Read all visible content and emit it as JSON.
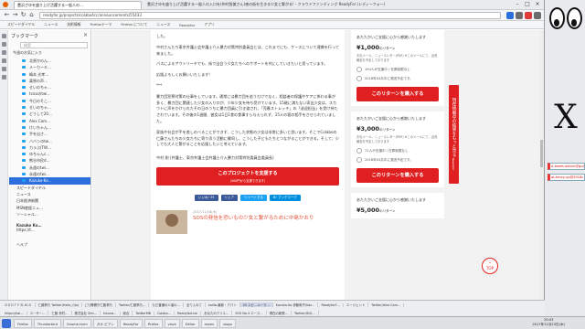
{
  "window": {
    "tab_title": "豊沢さゆを盛り上げ活躍する一般人の…",
    "title": "豊沢さゆを盛り上げ活躍する一般人の入口を(仲村智美さん)夜の街を生きる少女と繋がる! - クラウドファンディング ReadyFor (レディーフォー)",
    "url": "readyfor.jp/projects/colabo4cc/announcements/55433"
  },
  "bookmarks_bar": [
    "スピードダイヤル",
    "ニュース",
    "技術情報",
    "Firefoxテーマ",
    "Firefox について",
    "ニュース",
    "Readyfor",
    "アプリ"
  ],
  "sidebar": {
    "header": "ブックマーク",
    "search_placeholder": "検索",
    "folder": "今週のお気に入り",
    "items": [
      "北原かのん…",
      "メーカーキ…",
      "嶋本 光孝…",
      "栗原の声…",
      "せいのちゃ…",
      "tsicoのtwi…",
      "今日のそこ…",
      "せいのちゃ…",
      "どうして20…",
      "Alex Cam…",
      "けいちゃん…",
      "手を出さ…",
      "ババンのtw…",
      "カラぶ(TW…",
      "ゆちゃんc…",
      "熊谷市民d…",
      "永遠のtwi…",
      "永遠のtwi…",
      "Kazuko-Ko…"
    ],
    "selected_index": 18,
    "sections": [
      "スピードダイヤル",
      "ニュース",
      "日本経済新聞",
      "MSN産経ニュ…",
      "ソーシャル…"
    ],
    "user_name": "Kazuko Ko…",
    "user_line": "https://t…",
    "bottom_label": "ヘルプ"
  },
  "article": {
    "paragraphs": [
      "した。",
      "中村さんたち東京弁護士会弁護士介入暴力対策特別委員会とは、これまでにも、ケースについて連携を行って来ました。",
      "バスによるアウトリーチでも、街で出会う少女たちへのサポートを共にしていきたいと思っています。",
      "応援よろしくお願いいたします!",
      "***",
      "暴力団犯罪対策の仕事をしています。通常には暴力団を追うだけでなく、相談者の保護やケアに係わる事が多く、暴力団に関連した少女の入り口が、少年少女を待ち受けています。15歳に満たない家出少女は、スカウトに声をかけられたその日のうちに暴力団員に引き渡され、「売春ストレッチ」の「送迎担当」を受け持たされています。その後の1週間、彼女は1日1食の食事すら与えられず、15人の客の相手をさせられていました。",
      "家族や社会が手を差しのべることができず、こうした状態の少女は非常に多いと思います。そこでColaboの仁藤さんたちの少女たちに寄り添う活動に賛同し、こうした子どもたちとつながることができる。そして、少しでも大人と繋がることを応援したいと考えています。",
      "中村 剛 (弁護士、東京弁護士会弁護士介入暴力対策特別委員会委員長)"
    ],
    "cta_main": "このプロジェクトを支援する",
    "cta_sub": "(500円から支援できます)",
    "share": [
      {
        "label": "いいね! 35",
        "color": "#3b5998"
      },
      {
        "label": "シェア",
        "color": "#3b5998"
      },
      {
        "label": "ツイートする",
        "color": "#1da1f2"
      },
      {
        "label": "B! ブックマーク",
        "color": "#008fde"
      }
    ],
    "related_date": "2017/11/16(木)",
    "related_title": "SOSの発信を恐いもの少女と繋がるために中島かおり"
  },
  "rewards": [
    {
      "header": "あたたかいご支援に心から感謝いたします",
      "price": "¥1,000",
      "suffix": "のリターン",
      "desc": "お礼メール、ニュースレター(PDF) ※このメールにて、近況報告を予定しております",
      "supporters": "194人が支援中 / 在庫制限なし",
      "delivery": "2018年03月中に発送予定です。",
      "button": "このリターンを購入する"
    },
    {
      "header": "あたたかいご支援に心から感謝いたします",
      "price": "¥3,000",
      "suffix": "のリターン",
      "desc": "お礼メール、ニュースレター(PDF) ※このメールにて、近況報告を予定しております",
      "supporters": "71人が支援中 / 在庫制限なし",
      "delivery": "2018年03月中に発送予定です。",
      "button": "このリターンを購入する"
    },
    {
      "header": "あたたかいご支援に心から感謝いたします",
      "price": "¥5,000",
      "suffix": "のリターン",
      "desc": "",
      "supporters": "",
      "delivery": "",
      "button": ""
    }
  ],
  "badge": {
    "text": "現在挑戦中の結果をもっと見る",
    "brand": "Readyfor"
  },
  "top_button": "TOP",
  "desktop_notes": [
    "d-tweet-admin@gulp.io.jp",
    "at-tenzy-up@2018c 2017/11/"
  ],
  "inner_taskbar": [
    [
      "ＤＤＤＴＦＢ-Ｍ-Ｄ",
      "仁藤夢乃 Twitter(Helio_Ojo)",
      "[フ]警察庁仁藤夢乃",
      "Twitter/仁藤夢乃…",
      "ただ普通の人達の…",
      "全て入れて",
      "kalifa-最新・アパン",
      "20 スピ…ルーラ…",
      "Kazuko-Ko 伊藤和子/Kaz…",
      "ReadyforF…",
      "エージェント",
      "Twitter/Alex Cam…"
    ],
    [
      "https://twi…",
      "ユーザー…",
      "仁藤 仲村…",
      "株式会社 Zen…",
      "kizuna…",
      "総合",
      "TwitterMB",
      "Colabo…",
      "ReadyforLive",
      "あなたのクリエ…",
      "SOS No.3 エース…",
      "現在の新規…",
      "Twitter/ゆの…"
    ]
  ],
  "system_taskbar": [
    "Firefox",
    "Thunderbird",
    "Gnome-term",
    "ガオ-ピアン",
    "ReadyFor",
    "Firefox",
    "vlock",
    "Editor",
    "xeyes",
    "xlogo"
  ],
  "clock": {
    "time": "20:03",
    "date": "2017年11月23日(木)"
  }
}
